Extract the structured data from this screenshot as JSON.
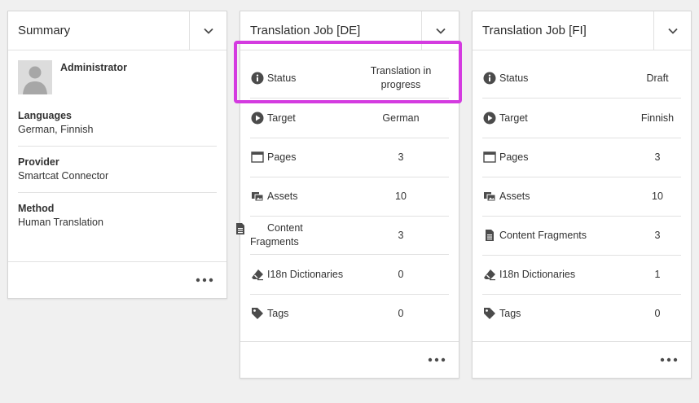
{
  "summary": {
    "title": "Summary",
    "user": "Administrator",
    "sections": [
      {
        "label": "Languages",
        "value": "German, Finnish"
      },
      {
        "label": "Provider",
        "value": "Smartcat Connector"
      },
      {
        "label": "Method",
        "value": "Human Translation"
      }
    ]
  },
  "jobs": [
    {
      "title": "Translation Job [DE]",
      "rows": [
        {
          "icon": "info-icon",
          "label": "Status",
          "value": "Translation in progress"
        },
        {
          "icon": "play-icon",
          "label": "Target",
          "value": "German"
        },
        {
          "icon": "pages-icon",
          "label": "Pages",
          "value": "3"
        },
        {
          "icon": "assets-icon",
          "label": "Assets",
          "value": "10"
        },
        {
          "icon": "document-icon",
          "label": "Content Fragments",
          "value": "3"
        },
        {
          "icon": "eraser-icon",
          "label": "I18n Dictionaries",
          "value": "0"
        },
        {
          "icon": "tag-icon",
          "label": "Tags",
          "value": "0"
        }
      ]
    },
    {
      "title": "Translation Job [FI]",
      "rows": [
        {
          "icon": "info-icon",
          "label": "Status",
          "value": "Draft"
        },
        {
          "icon": "play-icon",
          "label": "Target",
          "value": "Finnish"
        },
        {
          "icon": "pages-icon",
          "label": "Pages",
          "value": "3"
        },
        {
          "icon": "assets-icon",
          "label": "Assets",
          "value": "10"
        },
        {
          "icon": "document-icon",
          "label": "Content Fragments",
          "value": "3"
        },
        {
          "icon": "eraser-icon",
          "label": "I18n Dictionaries",
          "value": "1"
        },
        {
          "icon": "tag-icon",
          "label": "Tags",
          "value": "0"
        }
      ]
    }
  ],
  "colors": {
    "highlight": "#d43be0",
    "icon": "#4b4b4b"
  }
}
